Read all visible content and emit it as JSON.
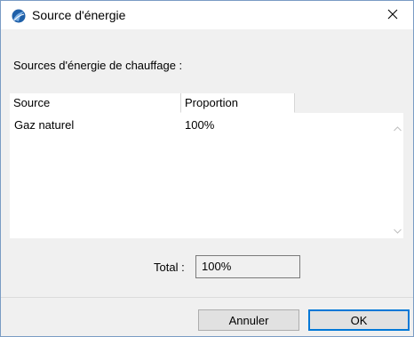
{
  "window": {
    "title": "Source d'énergie",
    "icon": "archicad-app-icon",
    "close_icon": "close-icon"
  },
  "section": {
    "label": "Sources d'énergie de chauffage :"
  },
  "table": {
    "columns": [
      "Source",
      "Proportion"
    ],
    "rows": [
      {
        "source": "Gaz naturel",
        "proportion": "100%"
      }
    ]
  },
  "total": {
    "label": "Total :",
    "value": "100%"
  },
  "buttons": {
    "cancel": "Annuler",
    "ok": "OK"
  },
  "colors": {
    "accent": "#0078d7",
    "window_bg": "#f0f0f0",
    "table_bg": "#ffffff"
  }
}
